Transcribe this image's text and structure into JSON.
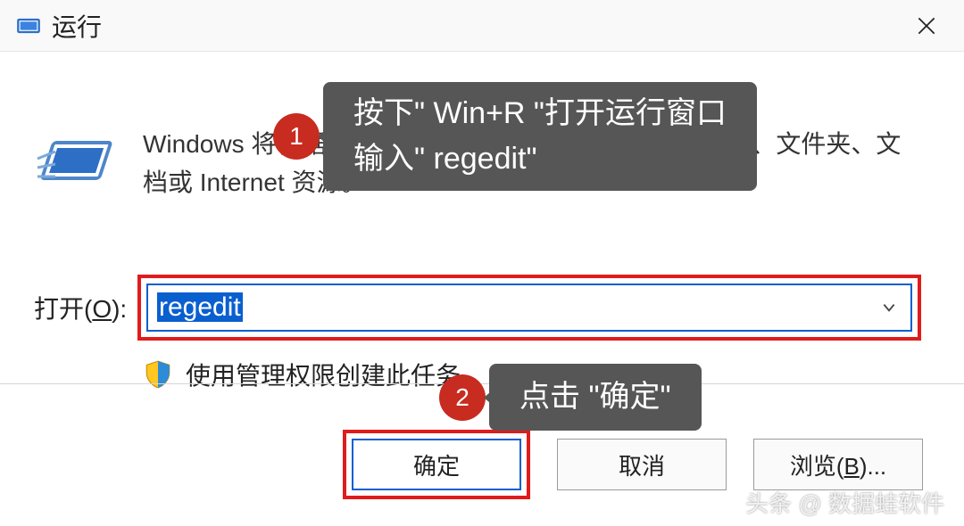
{
  "titlebar": {
    "title": "运行"
  },
  "body": {
    "description": "Windows 将根据你所输入的名称，为你打开相应的程序、文件夹、文档或 Internet 资源。",
    "open_label_pre": "打开(",
    "open_label_u": "O",
    "open_label_post": "):",
    "input_value": "regedit",
    "admin_note": "使用管理权限创建此任务。"
  },
  "buttons": {
    "ok": "确定",
    "cancel": "取消",
    "browse_pre": "浏览(",
    "browse_u": "B",
    "browse_post": ")..."
  },
  "callouts": {
    "one_num": "1",
    "one_text": "按下\"  Win+R  \"打开运行窗口\n输入\" regedit\"",
    "two_num": "2",
    "two_text": "点击 \"确定\""
  },
  "watermark": "头条 @ 数据蛙软件"
}
